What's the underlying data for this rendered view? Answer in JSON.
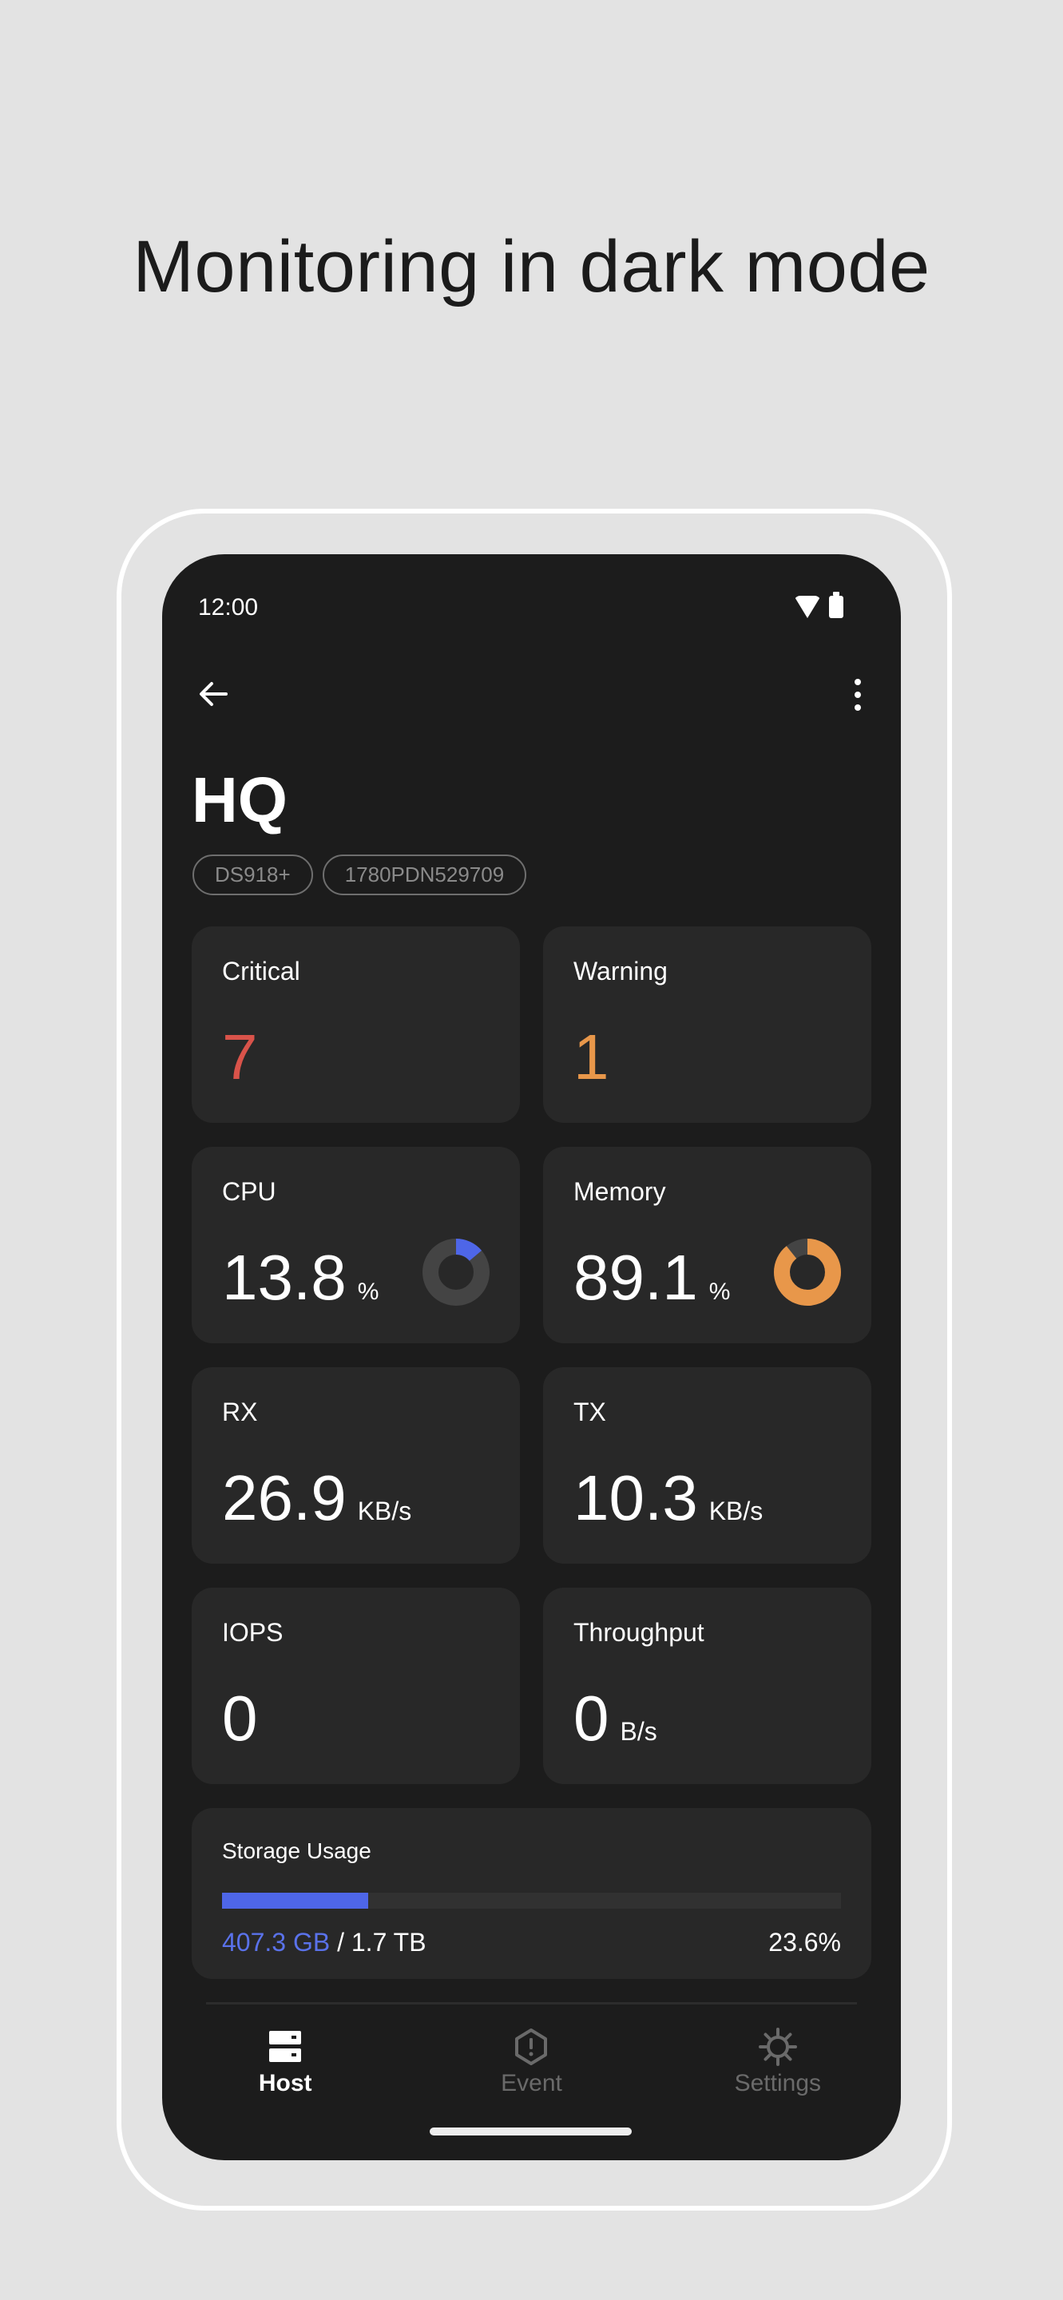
{
  "headline": "Monitoring in dark mode",
  "status_bar": {
    "time": "12:00",
    "icons": [
      "wifi-icon",
      "battery-icon"
    ]
  },
  "app_bar": {
    "back_icon": "arrow-left-icon",
    "menu_icon": "more-vert-icon"
  },
  "host": {
    "name": "HQ",
    "chips": [
      "DS918+",
      "1780PDN529709"
    ]
  },
  "cards": {
    "critical": {
      "label": "Critical",
      "value": "7",
      "color": "#d9534a"
    },
    "warning": {
      "label": "Warning",
      "value": "1",
      "color": "#e8974a"
    },
    "cpu": {
      "label": "CPU",
      "value": "13.8",
      "unit": "%",
      "percent": 13.8,
      "color": "#4e66e8",
      "track": "#444444"
    },
    "memory": {
      "label": "Memory",
      "value": "89.1",
      "unit": "%",
      "percent": 89.1,
      "color": "#e8974a",
      "track": "#444444"
    },
    "rx": {
      "label": "RX",
      "value": "26.9",
      "unit": "KB/s"
    },
    "tx": {
      "label": "TX",
      "value": "10.3",
      "unit": "KB/s"
    },
    "iops": {
      "label": "IOPS",
      "value": "0"
    },
    "throughput": {
      "label": "Throughput",
      "value": "0",
      "unit": "B/s"
    }
  },
  "storage": {
    "label": "Storage Usage",
    "used": "407.3 GB",
    "separator_total": " / 1.7 TB",
    "percent_label": "23.6%",
    "percent": 23.6,
    "color": "#4e66e8"
  },
  "nav": {
    "items": [
      {
        "label": "Host",
        "icon": "server-icon",
        "active": true
      },
      {
        "label": "Event",
        "icon": "alert-hexagon-icon",
        "active": false
      },
      {
        "label": "Settings",
        "icon": "gear-icon",
        "active": false
      }
    ]
  }
}
